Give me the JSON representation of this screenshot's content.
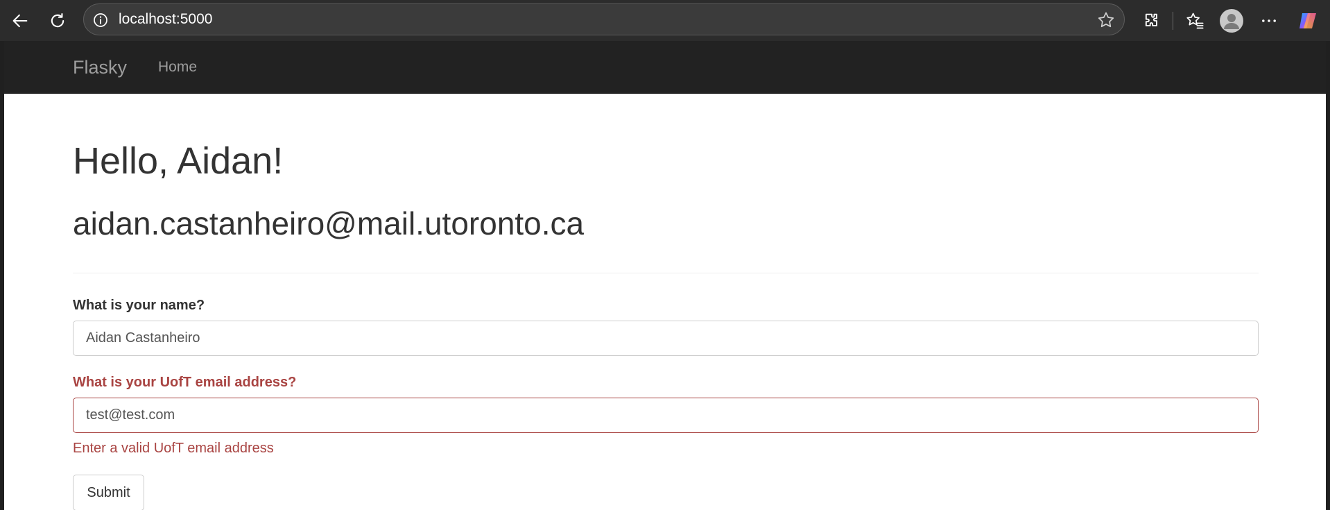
{
  "browser": {
    "url": "localhost:5000",
    "icons": [
      "back-icon",
      "reload-icon",
      "site-info-icon",
      "favorite-star-icon",
      "extensions-icon",
      "favorites-icon",
      "profile-avatar-icon",
      "more-icon",
      "copilot-icon"
    ]
  },
  "navbar": {
    "brand": "Flasky",
    "links": [
      {
        "label": "Home"
      }
    ]
  },
  "main": {
    "greeting": "Hello, Aidan!",
    "email": "aidan.castanheiro@mail.utoronto.ca"
  },
  "form": {
    "name_label": "What is your name?",
    "name_value": "Aidan Castanheiro",
    "email_label": "What is your UofT email address?",
    "email_value": "test@test.com",
    "email_error": "Enter a valid UofT email address",
    "submit_label": "Submit"
  },
  "colors": {
    "navbar_bg": "#222222",
    "error": "#a94442",
    "text": "#333333"
  }
}
